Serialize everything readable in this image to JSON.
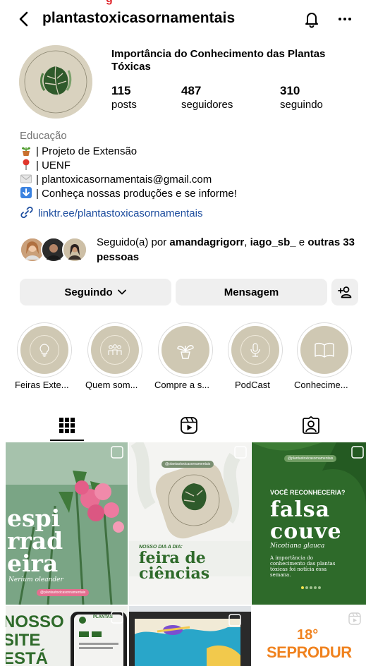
{
  "header": {
    "username": "plantastoxicasornamentais"
  },
  "profile": {
    "name": "Importância do Conhecimento das Plantas Tóxicas",
    "avatar_text": "PLANTAS TÓXICAS ORNAMENTAIS",
    "stats": [
      {
        "value": "115",
        "label": "posts"
      },
      {
        "value": "487",
        "label": "seguidores"
      },
      {
        "value": "310",
        "label": "seguindo"
      }
    ],
    "category": "Educação",
    "bio": [
      {
        "icon": "potted-plant-icon",
        "text": "| Projeto de Extensão"
      },
      {
        "icon": "pin-icon",
        "text": "| UENF"
      },
      {
        "icon": "envelope-icon",
        "text": "| plantoxicasornamentais@gmail.com"
      },
      {
        "icon": "down-arrow-icon",
        "text": "| Conheça nossas produções e se informe!"
      }
    ],
    "link": "linktr.ee/plantastoxicasornamentais",
    "followed_by": {
      "prefix": "Seguido(a) por ",
      "user1": "amandagrigorr",
      "sep": ", ",
      "user2": "iago_sb_",
      "and": " e ",
      "others": "outras 33 pessoas"
    }
  },
  "actions": {
    "following_label": "Seguindo",
    "message_label": "Mensagem"
  },
  "highlights": [
    {
      "label": "Feiras Exte...",
      "icon": "lightbulb-icon"
    },
    {
      "label": "Quem som...",
      "icon": "people-icon"
    },
    {
      "label": "Compre a s...",
      "icon": "seedling-pot-icon"
    },
    {
      "label": "PodCast",
      "icon": "microphone-icon"
    },
    {
      "label": "Conhecime...",
      "icon": "open-book-icon"
    }
  ],
  "tabs": [
    {
      "name": "grid",
      "icon": "grid-icon",
      "active": true
    },
    {
      "name": "reels",
      "icon": "reels-icon",
      "active": false
    },
    {
      "name": "tagged",
      "icon": "tagged-icon",
      "active": false
    }
  ],
  "posts": [
    {
      "title_lines": [
        "espi",
        "rrad",
        "eira"
      ],
      "subtitle": "Nerium oleander",
      "tag": "@plantastoxicasornamentais"
    },
    {
      "tag": "@plantastoxicasornamentais",
      "kicker": "NOSSO DIA A DIA:",
      "title_lines": [
        "feira de",
        "ciências"
      ]
    },
    {
      "tag": "@plantastoxicasornamentais",
      "kicker": "VOCÊ RECONHECERIA?",
      "title_lines": [
        "falsa",
        "couve"
      ],
      "subtitle": "Nicotiana glauca",
      "body": [
        "A importância do",
        "conhecimento das plantas",
        "tóxicas foi notícia essa",
        "semana."
      ]
    },
    {
      "title_lines": [
        "NOSSO",
        "SITE",
        "ESTÁ"
      ],
      "phone_text": "PLANTAS"
    },
    {
      "title_lines": []
    },
    {
      "title_lines": [
        "18°",
        "SEPRODUR"
      ]
    }
  ],
  "colors": {
    "accent_link": "#1d4d9e",
    "button_bg": "#efefef",
    "highlight_bg": "#cfc8b3",
    "post_green": "#2e6a2a",
    "seprodur_orange": "#f0821e"
  }
}
